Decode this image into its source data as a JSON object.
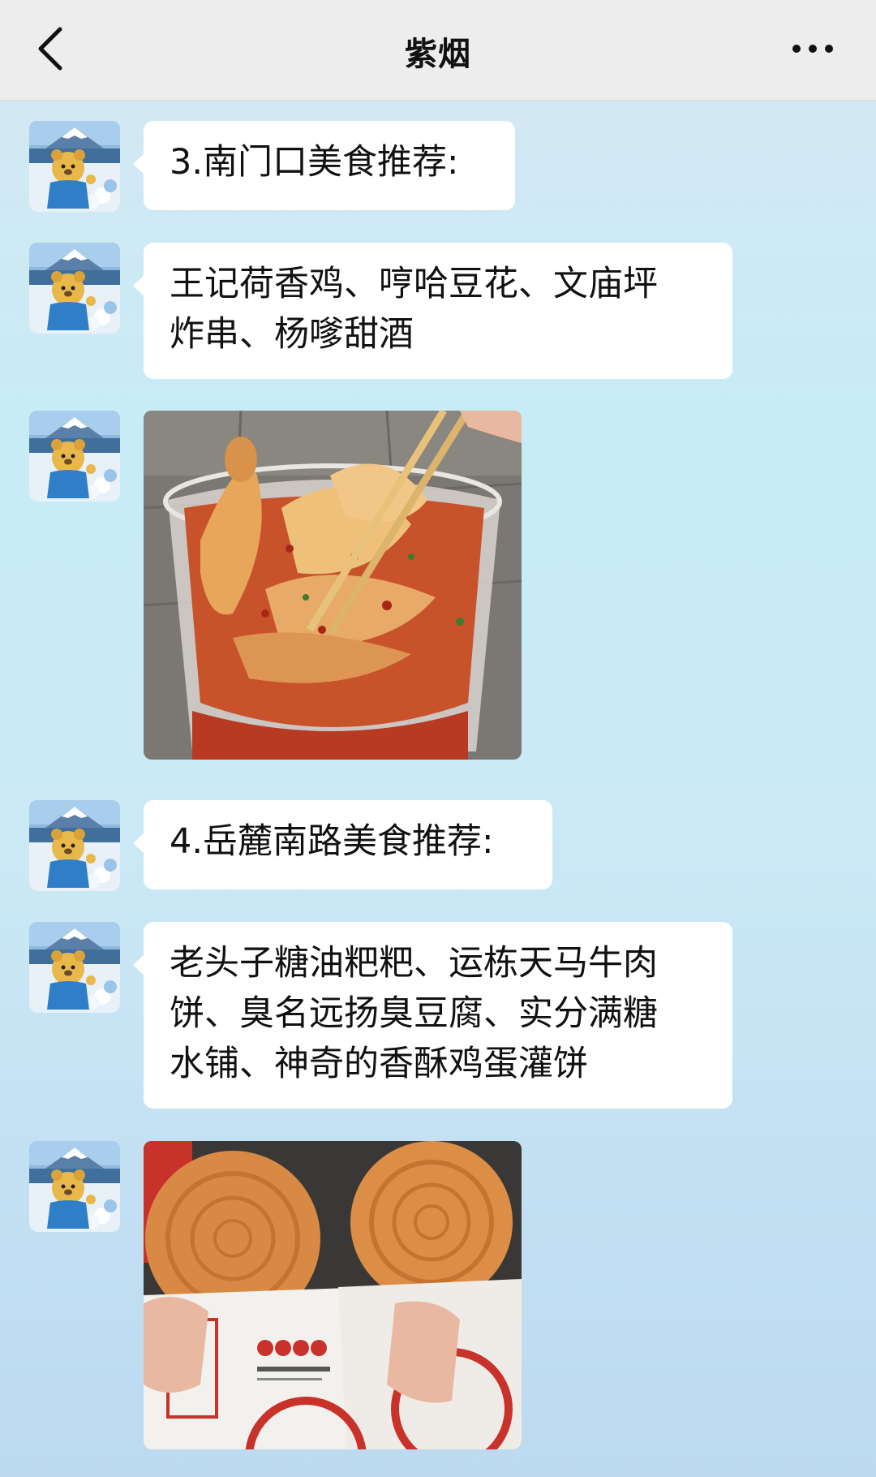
{
  "header": {
    "title": "紫烟",
    "back_icon": "chevron-left-icon",
    "more_icon": "more-dots-icon"
  },
  "messages": [
    {
      "type": "text",
      "text": "3.南门口美食推荐:"
    },
    {
      "type": "text",
      "lines": [
        "王记荷香鸡、哼哈豆花、文庙坪",
        "炸串、杨嗲甜酒"
      ]
    },
    {
      "type": "image",
      "subject": "spicy chicken in plastic bowl with chopsticks"
    },
    {
      "type": "text",
      "text": "4.岳麓南路美食推荐:"
    },
    {
      "type": "text",
      "lines": [
        "老头子糖油粑粑、运栋天马牛肉",
        "饼、臭名远扬臭豆腐、实分满糖",
        "水铺、神奇的香酥鸡蛋灌饼"
      ]
    },
    {
      "type": "image",
      "subject": "two flaky pastries in paper bags"
    }
  ],
  "colors": {
    "header_bg": "#ededed",
    "bubble_bg": "#ffffff",
    "text": "#111111"
  }
}
